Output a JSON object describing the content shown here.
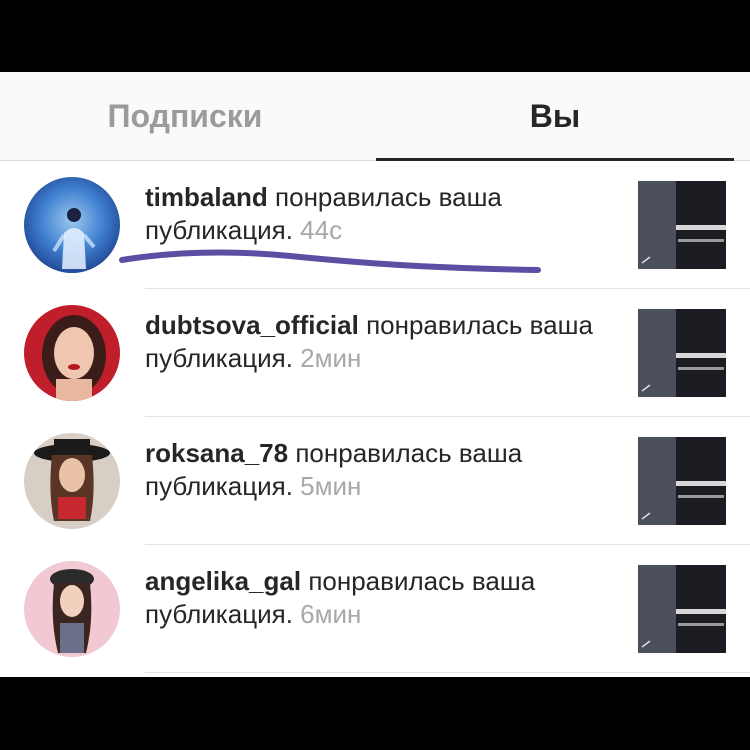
{
  "tabs": {
    "following_label": "Подписки",
    "you_label": "Вы",
    "active": "you"
  },
  "notifications": [
    {
      "username": "timbaland",
      "action": "понравилась ваша публикация.",
      "time": "44с",
      "avatar_icon": "user-avatar-photo-blue",
      "thumbnail_icon": "post-thumbnail"
    },
    {
      "username": "dubtsova_official",
      "action": "понравилась ваша публикация.",
      "time": "2мин",
      "avatar_icon": "user-avatar-photo-red",
      "thumbnail_icon": "post-thumbnail"
    },
    {
      "username": "roksana_78",
      "action": "понравилась ваша публикация.",
      "time": "5мин",
      "avatar_icon": "user-avatar-photo-hat",
      "thumbnail_icon": "post-thumbnail"
    },
    {
      "username": "angelika_gal",
      "action": "понравилась ваша публикация.",
      "time": "6мин",
      "avatar_icon": "user-avatar-photo-pink",
      "thumbnail_icon": "post-thumbnail"
    }
  ],
  "annotation": {
    "type": "handwritten-underline",
    "color": "#5a4fa3",
    "target": "notifications.0"
  },
  "colors": {
    "text": "#262626",
    "muted": "#a8a8a8",
    "inactive_tab": "#9b9b9b",
    "tab_bar": "#fafafa"
  }
}
